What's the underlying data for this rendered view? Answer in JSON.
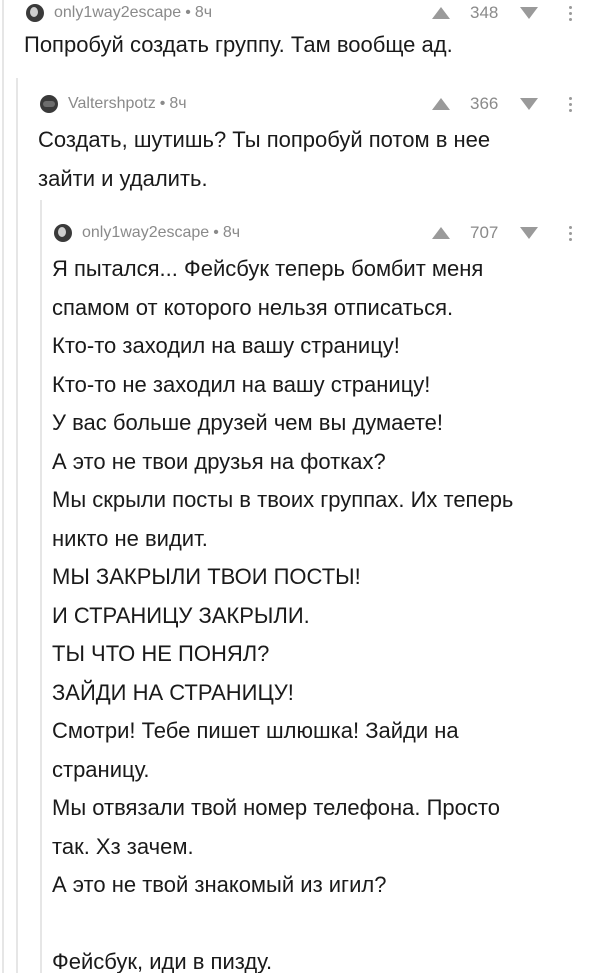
{
  "comments": [
    {
      "username": "only1way2escape",
      "age": "8ч",
      "score": "348",
      "text": "Попробуй создать группу. Там вообще ад."
    },
    {
      "username": "Valtershpotz",
      "age": "8ч",
      "score": "366",
      "lines": [
        "Создать, шутишь? Ты попробуй потом в нее",
        "зайти и удалить."
      ]
    },
    {
      "username": "only1way2escape",
      "age": "8ч",
      "score": "707",
      "lines": [
        "Я пытался... Фейсбук теперь бомбит меня",
        "спамом от которого нельзя отписаться.",
        "Кто-то заходил на вашу страницу!",
        "Кто-то не заходил на вашу страницу!",
        "У вас больше друзей чем вы думаете!",
        "А это не твои друзья на фотках?",
        "Мы скрыли посты в твоих группах. Их теперь",
        "никто не видит.",
        "МЫ ЗАКРЫЛИ ТВОИ ПОСТЫ!",
        "И СТРАНИЦУ ЗАКРЫЛИ.",
        "ТЫ ЧТО НЕ ПОНЯЛ?",
        "ЗАЙДИ НА СТРАНИЦУ!",
        "Смотри! Тебе пишет шлюшка! Зайди на",
        "страницу.",
        "Мы отвязали твой номер телефона. Просто",
        "так. Хз зачем.",
        "А это не твой знакомый из игил?",
        "",
        "Фейсбук, иди в пизду."
      ]
    }
  ]
}
